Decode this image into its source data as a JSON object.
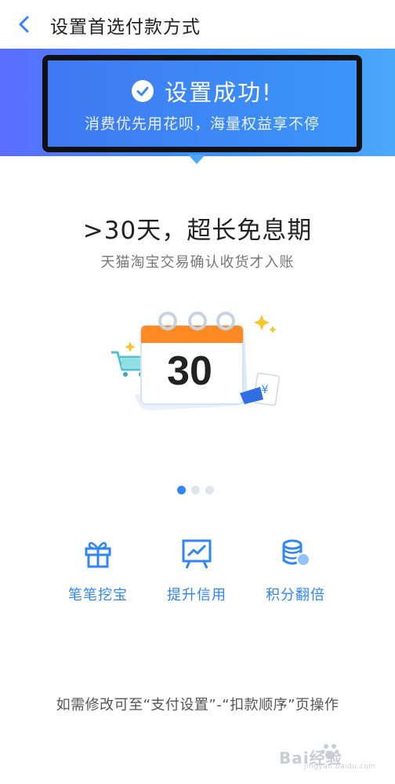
{
  "nav": {
    "title": "设置首选付款方式"
  },
  "banner": {
    "title": "设置成功!",
    "subtitle": "消费优先用花呗，海量权益享不停"
  },
  "promo": {
    "headline": ">30天，超长免息期",
    "subline": "天猫淘宝交易确认收货才入账",
    "calendar_number": "30",
    "currency_symbol": "¥"
  },
  "carousel": {
    "pages": 3,
    "active_index": 0
  },
  "features": [
    {
      "label": "笔笔挖宝",
      "icon": "gift-icon"
    },
    {
      "label": "提升信用",
      "icon": "chart-board-icon"
    },
    {
      "label": "积分翻倍",
      "icon": "coins-icon"
    }
  ],
  "footer": {
    "note": "如需修改可至“支付设置”-“扣款顺序”页操作"
  },
  "watermark": {
    "text": "Bai经验",
    "sub": "jingyan.baidu.com"
  },
  "colors": {
    "accent": "#2f86f6",
    "banner_start": "#5b6dff",
    "banner_end": "#4aa8fb",
    "calendar_orange": "#ff8a24"
  }
}
